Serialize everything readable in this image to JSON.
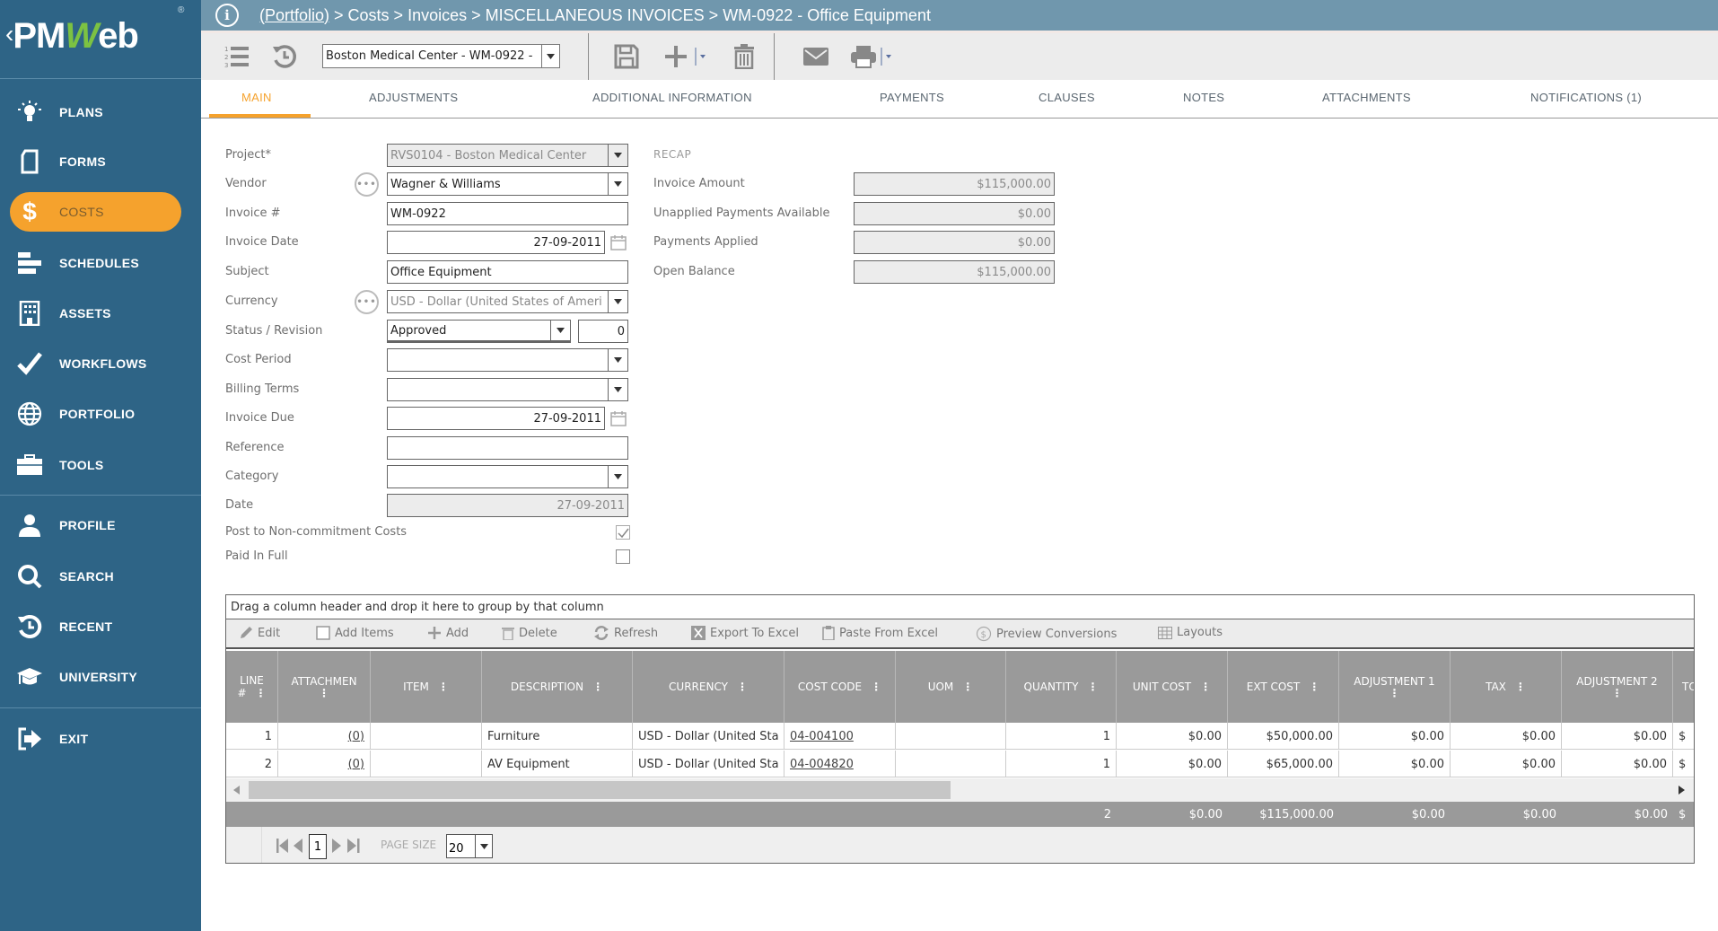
{
  "app": {
    "logo_text_pm": "PM",
    "logo_text_w": "W",
    "logo_text_eb": "eb",
    "logo_reg": "®",
    "logo_back": "‹"
  },
  "colors": {
    "sidebar_bg": "#2e6486",
    "accent": "#f5a22d",
    "topbar_bg": "#7097ad",
    "grid_header_bg": "#9a9a9a"
  },
  "sidebar": {
    "items": [
      {
        "label": "PLANS",
        "icon": "lightbulb-icon"
      },
      {
        "label": "FORMS",
        "icon": "document-icon"
      },
      {
        "label": "COSTS",
        "icon": "dollar-icon",
        "active": true
      },
      {
        "label": "SCHEDULES",
        "icon": "schedule-bars-icon"
      },
      {
        "label": "ASSETS",
        "icon": "building-icon"
      },
      {
        "label": "WORKFLOWS",
        "icon": "checkmark-icon"
      },
      {
        "label": "PORTFOLIO",
        "icon": "globe-icon"
      },
      {
        "label": "TOOLS",
        "icon": "toolbox-icon"
      },
      {
        "label": "PROFILE",
        "icon": "user-icon"
      },
      {
        "label": "SEARCH",
        "icon": "search-icon"
      },
      {
        "label": "RECENT",
        "icon": "history-icon"
      },
      {
        "label": "UNIVERSITY",
        "icon": "graduation-cap-icon"
      },
      {
        "label": "EXIT",
        "icon": "exit-icon"
      }
    ]
  },
  "header": {
    "breadcrumb_link": "(Portfolio)",
    "breadcrumb_rest": " > Costs > Invoices > MISCELLANEOUS INVOICES > WM-0922 - Office Equipment"
  },
  "toolbar": {
    "record_selector_value": "Boston Medical Center - WM-0922 -"
  },
  "tabs": [
    {
      "label": "MAIN",
      "active": true
    },
    {
      "label": "ADJUSTMENTS"
    },
    {
      "label": "ADDITIONAL INFORMATION"
    },
    {
      "label": "PAYMENTS"
    },
    {
      "label": "CLAUSES"
    },
    {
      "label": "NOTES"
    },
    {
      "label": "ATTACHMENTS"
    },
    {
      "label": "NOTIFICATIONS (1)"
    }
  ],
  "form": {
    "project_label": "Project*",
    "project_value": "RVS0104 - Boston Medical Center",
    "vendor_label": "Vendor",
    "vendor_value": "Wagner & Williams",
    "invoice_no_label": "Invoice #",
    "invoice_no_value": "WM-0922",
    "invoice_date_label": "Invoice Date",
    "invoice_date_value": "27-09-2011",
    "subject_label": "Subject",
    "subject_value": "Office Equipment",
    "currency_label": "Currency",
    "currency_value": "USD - Dollar (United States of Ameri",
    "status_label": "Status / Revision",
    "status_value": "Approved",
    "revision_value": "0",
    "cost_period_label": "Cost Period",
    "cost_period_value": "",
    "billing_terms_label": "Billing Terms",
    "billing_terms_value": "",
    "invoice_due_label": "Invoice Due",
    "invoice_due_value": "27-09-2011",
    "reference_label": "Reference",
    "reference_value": "",
    "category_label": "Category",
    "category_value": "",
    "date_label": "Date",
    "date_value": "27-09-2011",
    "post_noncommitment_label": "Post to Non-commitment Costs",
    "post_noncommitment_checked": true,
    "paid_in_full_label": "Paid In Full",
    "paid_in_full_checked": false
  },
  "recap": {
    "title": "RECAP",
    "invoice_amount_label": "Invoice Amount",
    "invoice_amount_value": "$115,000.00",
    "unapplied_label": "Unapplied Payments Available",
    "unapplied_value": "$0.00",
    "payments_applied_label": "Payments Applied",
    "payments_applied_value": "$0.00",
    "open_balance_label": "Open Balance",
    "open_balance_value": "$115,000.00"
  },
  "grid": {
    "group_hint": "Drag a column header and drop it here to group by that column",
    "toolbar": {
      "edit": "Edit",
      "add_items": "Add Items",
      "add": "Add",
      "delete": "Delete",
      "refresh": "Refresh",
      "export": "Export To Excel",
      "paste": "Paste From Excel",
      "preview": "Preview Conversions",
      "layouts": "Layouts"
    },
    "columns": [
      {
        "line1": "LINE",
        "line2": "#"
      },
      {
        "line1": "ATTACHMEN",
        "line2": ""
      },
      {
        "line1": "ITEM"
      },
      {
        "line1": "DESCRIPTION"
      },
      {
        "line1": "CURRENCY"
      },
      {
        "line1": "COST CODE"
      },
      {
        "line1": "UOM"
      },
      {
        "line1": "QUANTITY"
      },
      {
        "line1": "UNIT COST"
      },
      {
        "line1": "EXT COST"
      },
      {
        "line1": "ADJUSTMENT 1",
        "line2": ""
      },
      {
        "line1": "TAX"
      },
      {
        "line1": "ADJUSTMENT 2",
        "line2": ""
      },
      {
        "line1": "TOT"
      }
    ],
    "rows": [
      {
        "line": "1",
        "attachments": "(0)",
        "item": "",
        "description": "Furniture",
        "currency": "USD - Dollar (United Sta",
        "cost_code": "04-004100",
        "uom": "",
        "quantity": "1",
        "unit_cost": "$0.00",
        "ext_cost": "$50,000.00",
        "adj1": "$0.00",
        "tax": "$0.00",
        "adj2": "$0.00",
        "tot": "$"
      },
      {
        "line": "2",
        "attachments": "(0)",
        "item": "",
        "description": "AV Equipment",
        "currency": "USD - Dollar (United Sta",
        "cost_code": "04-004820",
        "uom": "",
        "quantity": "1",
        "unit_cost": "$0.00",
        "ext_cost": "$65,000.00",
        "adj1": "$0.00",
        "tax": "$0.00",
        "adj2": "$0.00",
        "tot": "$"
      }
    ],
    "footer": {
      "quantity": "2",
      "unit_cost": "$0.00",
      "ext_cost": "$115,000.00",
      "adj1": "$0.00",
      "tax": "$0.00",
      "adj2": "$0.00",
      "tot": "$"
    },
    "pager": {
      "current_page": "1",
      "page_size_label": "PAGE SIZE",
      "page_size_value": "20"
    }
  }
}
